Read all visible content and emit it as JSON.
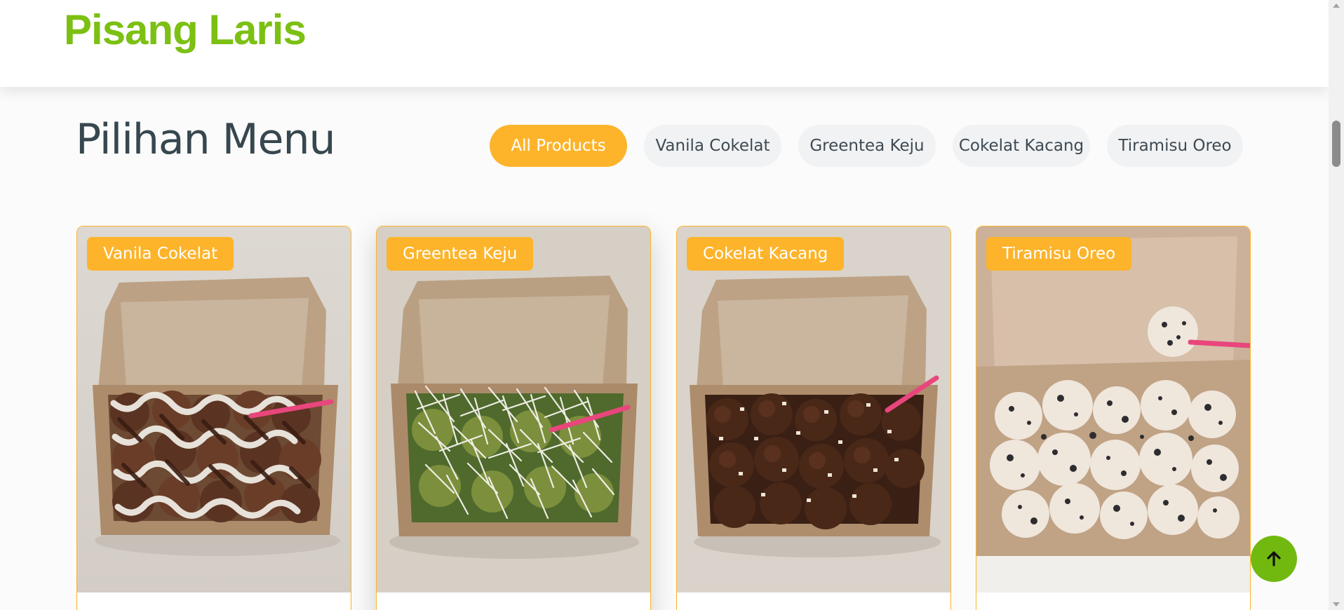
{
  "header": {
    "brand": "Pisang Laris"
  },
  "menu": {
    "title": "Pilihan Menu",
    "filters": [
      {
        "label": "All Products",
        "active": true
      },
      {
        "label": "Vanila Cokelat",
        "active": false
      },
      {
        "label": "Greentea Keju",
        "active": false
      },
      {
        "label": "Cokelat Kacang",
        "active": false
      },
      {
        "label": "Tiramisu Oreo",
        "active": false
      }
    ]
  },
  "products": [
    {
      "tag": "Vanila Cokelat",
      "photo": "box-of-fried-banana-with-chocolate-and-vanilla-drizzle"
    },
    {
      "tag": "Greentea Keju",
      "photo": "box-of-fried-banana-with-greentea-and-grated-cheese"
    },
    {
      "tag": "Cokelat Kacang",
      "photo": "box-of-fried-banana-with-chocolate-and-peanuts"
    },
    {
      "tag": "Tiramisu Oreo",
      "photo": "box-of-fried-banana-with-tiramisu-and-oreo-crumbs"
    }
  ],
  "colors": {
    "brand": "#7cc013",
    "accent": "#fdb42b",
    "heading": "#37474f",
    "back_to_top": "#71b90f"
  },
  "icons": {
    "back_to_top": "arrow-up-icon"
  }
}
